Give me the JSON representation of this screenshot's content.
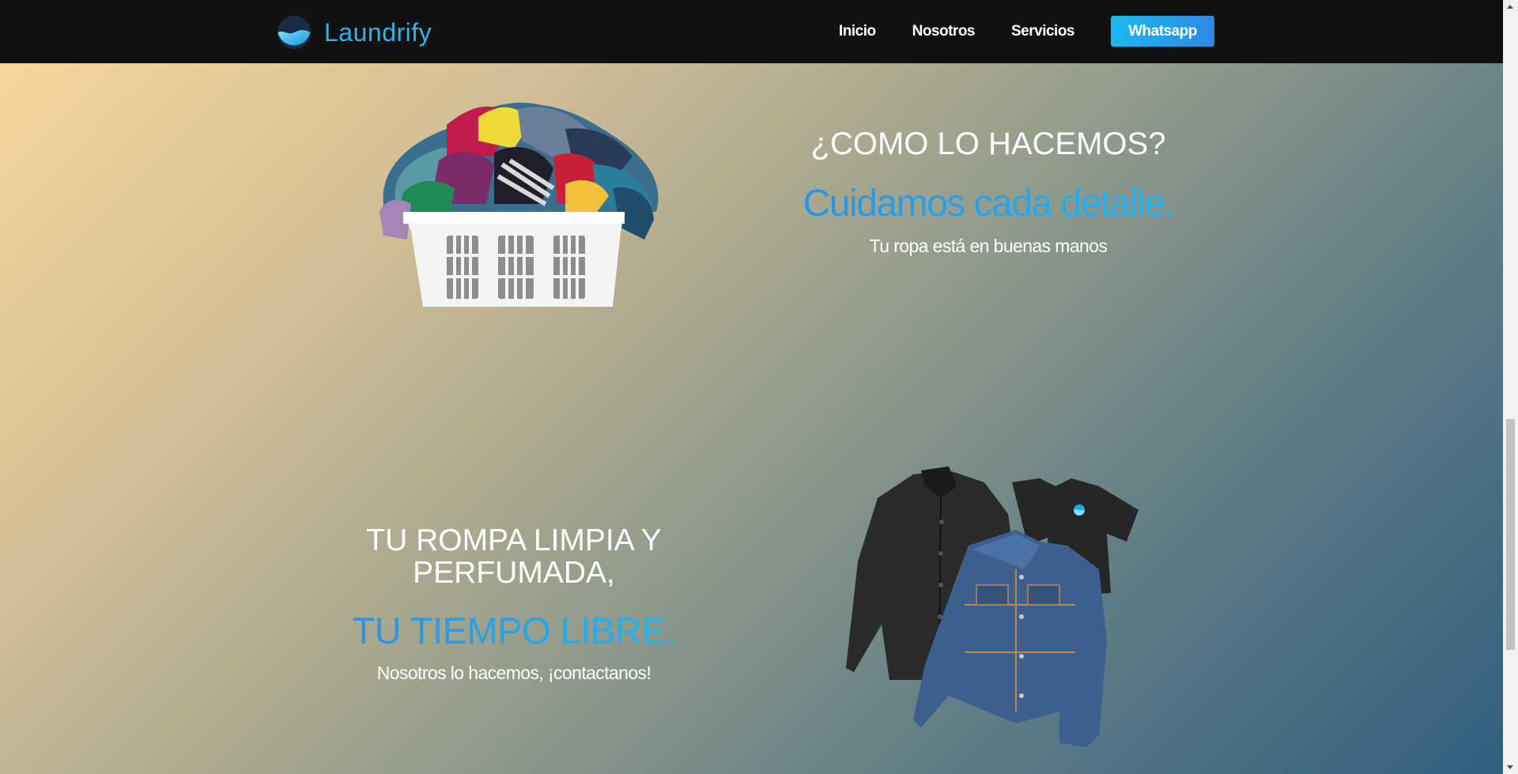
{
  "brand": {
    "name": "Laundrify",
    "accent": "#2cb4ef"
  },
  "nav": {
    "items": [
      {
        "label": "Inicio"
      },
      {
        "label": "Nosotros"
      },
      {
        "label": "Servicios"
      }
    ],
    "cta_label": "Whatsapp"
  },
  "section1": {
    "heading": "¿COMO LO HACEMOS?",
    "tagline": "Cuidamos cada detalle.",
    "subtext": "Tu ropa está en buenas manos",
    "image": "laundry-basket-image"
  },
  "section2": {
    "heading": "TU ROMPA LIMPIA Y PERFUMADA,",
    "tagline": "TU TIEMPO LIBRE.",
    "subtext": "Nosotros lo hacemos, ¡contactanos!",
    "image": "clothes-image"
  },
  "colors": {
    "navbar_bg": "#111111",
    "gradient_start": "#fcd79b",
    "gradient_end": "#2f5f80",
    "tagline_gradient_start": "#2c8fe4",
    "tagline_gradient_end": "#1fbaf2"
  }
}
